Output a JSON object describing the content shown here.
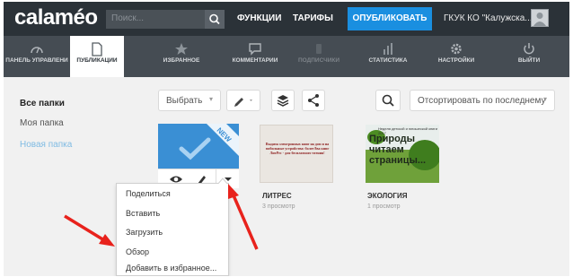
{
  "topbar": {
    "logo": "calaméo",
    "search_placeholder": "Поиск...",
    "links": [
      "ФУНКЦИИ",
      "ТАРИФЫ"
    ],
    "publish_label": "ОПУБЛИКОВАТЬ",
    "account_label": "ГКУК КО \"Калужска...",
    "brand_color": "#2b3238",
    "accent_color": "#1a8fe0"
  },
  "tabs": [
    {
      "label": "ПАНЕЛЬ УПРАВЛЕНИ",
      "icon": "dashboard-icon"
    },
    {
      "label": "ПУБЛИКАЦИИ",
      "icon": "document-icon"
    },
    {
      "label": "ИЗБРАННОЕ",
      "icon": "star-icon"
    },
    {
      "label": "КОММЕНТАРИИ",
      "icon": "comment-icon"
    },
    {
      "label": "ПОДПИСЧИКИ",
      "icon": "subscribers-icon"
    },
    {
      "label": "СТАТИСТИКА",
      "icon": "bar-chart-icon"
    },
    {
      "label": "НАСТРОЙКИ",
      "icon": "gear-icon"
    },
    {
      "label": "ВЫЙТИ",
      "icon": "power-icon"
    }
  ],
  "sidebar": {
    "folders": [
      "Все папки",
      "Моя папка"
    ],
    "new_folder": "Новая папка"
  },
  "toolbar": {
    "select_label": "Выбрать",
    "sort_label": "Отсортировать по последнему"
  },
  "cards": [
    {
      "title": "",
      "views": "",
      "badge": "NEW"
    },
    {
      "title": "ЛИТРЕС",
      "views": "3 просмотр",
      "cover_text": "Выдача электронных книг на дом и на мобильные устройства: более 8ва книг ЛитРес - для бесплатного чтения!"
    },
    {
      "title": "ЭКОЛОГИЯ",
      "views": "1 просмотр",
      "cover_big": "Природы читаем страницы...",
      "cover_small": "Неделя детской и юношеской книги 2017"
    }
  ],
  "menu": {
    "items": [
      "Поделиться",
      "Вставить",
      "Загрузить",
      "Обзор",
      "Добавить в избранное..."
    ]
  },
  "annotations": {
    "arrow_color": "#e8221c"
  }
}
